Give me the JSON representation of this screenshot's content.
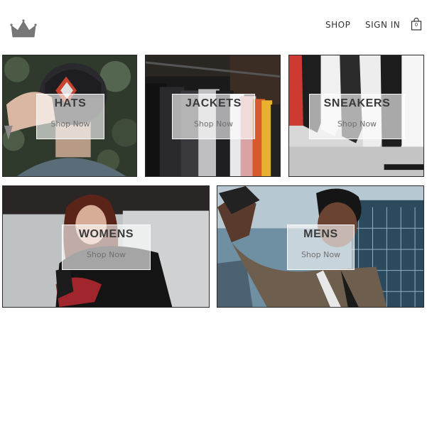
{
  "header": {
    "logo_icon": "crown-icon",
    "nav": {
      "shop_label": "SHOP",
      "signin_label": "SIGN IN"
    },
    "cart": {
      "icon": "shopping-bag-icon",
      "count": "0"
    }
  },
  "categories": [
    {
      "title": "HATS",
      "cta": "Shop Now"
    },
    {
      "title": "JACKETS",
      "cta": "Shop Now"
    },
    {
      "title": "SNEAKERS",
      "cta": "Shop Now"
    },
    {
      "title": "WOMENS",
      "cta": "Shop Now"
    },
    {
      "title": "MENS",
      "cta": "Shop Now"
    }
  ],
  "colors": {
    "text": "#333333",
    "tile_border": "#2a2a2a",
    "label_bg": "#ffffff",
    "logo": "#7a7a7a"
  }
}
